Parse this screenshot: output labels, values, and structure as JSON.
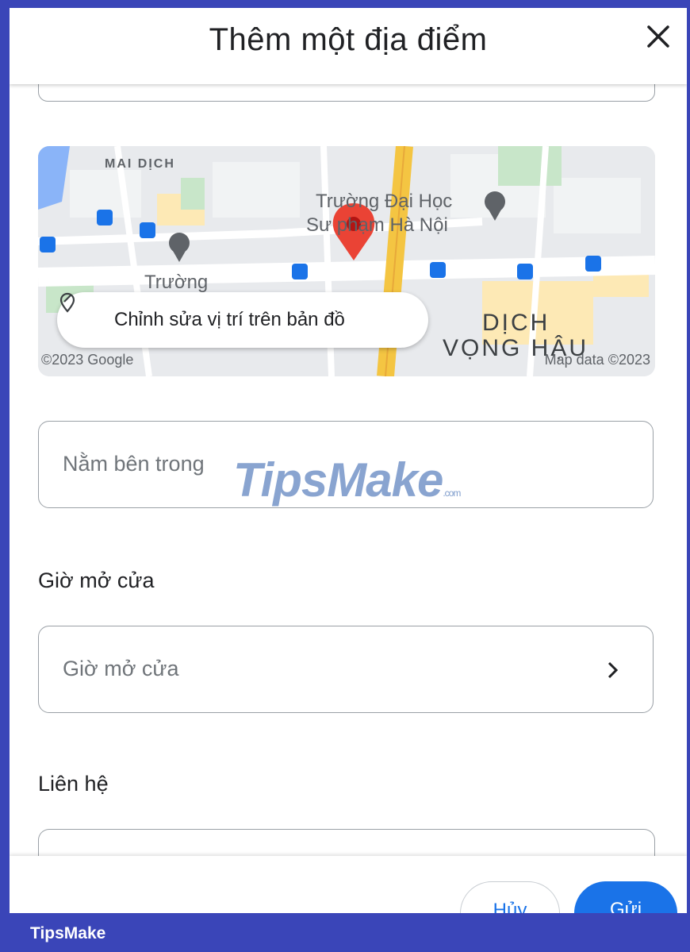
{
  "header": {
    "title": "Thêm một địa điểm",
    "close_icon": "close-icon"
  },
  "map": {
    "labels": {
      "mai_dich": "MAI DỊCH",
      "university_line1": "Trường Đại Học",
      "university_line2": "Sư phạm Hà Nội",
      "school": "Trường",
      "district_line1": "DỊCH",
      "district_line2": "VỌNG HẬU"
    },
    "copyright_left": "©2023 Google",
    "copyright_right": "Map data ©2023",
    "edit_button": {
      "label": "Chỉnh sửa vị trí trên bản đồ",
      "icon": "edit-pin-icon"
    },
    "colors": {
      "pin": "#ea4335",
      "road_major": "#f4c542",
      "park": "#c8e6c9",
      "water": "#8ab4f8",
      "transit": "#1a73e8"
    }
  },
  "inside_field": {
    "placeholder": "Nằm bên trong"
  },
  "hours_section": {
    "title": "Giờ mở cửa",
    "field_label": "Giờ mở cửa",
    "chevron_icon": "chevron-right-icon"
  },
  "contact_section": {
    "title": "Liên hệ"
  },
  "footer": {
    "cancel_label": "Hủy",
    "submit_label": "Gửi"
  },
  "watermarks": {
    "tipsmake": "TipsMake",
    "tipsmake_suffix": ".com",
    "brand_bar": "TipsMake"
  }
}
